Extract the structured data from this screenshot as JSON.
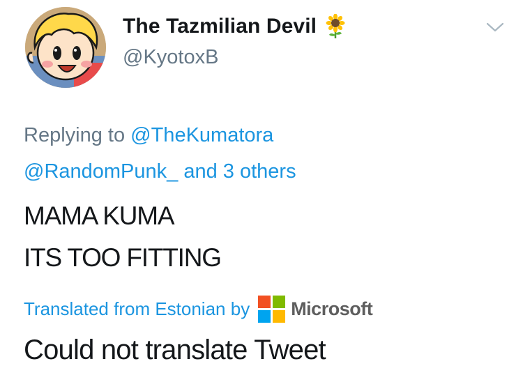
{
  "user": {
    "display_name": "The Tazmilian Devil",
    "handle": "@KyotoxB",
    "name_emoji": "sunflower-icon"
  },
  "reply_context": {
    "prefix": "Replying to",
    "mention_1": "@TheKumatora",
    "mention_2": "@RandomPunk_",
    "others": "and 3 others"
  },
  "tweet": {
    "line_1": "MAMA KUMA",
    "line_2": "ITS TOO FITTING"
  },
  "translation": {
    "label": "Translated from Estonian by",
    "provider": "Microsoft",
    "result": "Could not translate Tweet"
  },
  "colors": {
    "link": "#1b95e0",
    "secondary": "#657786",
    "ms_red": "#f25022",
    "ms_green": "#7fba00",
    "ms_blue": "#00a4ef",
    "ms_yellow": "#ffb900"
  }
}
